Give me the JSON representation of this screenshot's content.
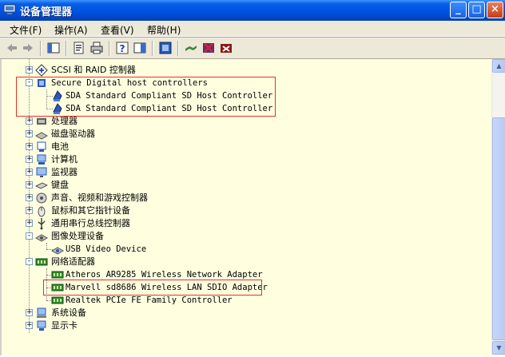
{
  "window": {
    "title": "设备管理器",
    "controls": {
      "minimize": "_",
      "maximize": "□",
      "close": "×"
    }
  },
  "menu": [
    {
      "label": "文件(F)"
    },
    {
      "label": "操作(A)"
    },
    {
      "label": "查看(V)"
    },
    {
      "label": "帮助(H)"
    }
  ],
  "toolbar": {
    "buttons": [
      "back-icon",
      "forward-icon",
      "console-tree-icon",
      "properties-icon",
      "print-icon",
      "help-icon",
      "show-hide-icon",
      "scan-hardware-icon",
      "update-driver-icon",
      "disable-icon",
      "uninstall-icon"
    ]
  },
  "tree": {
    "items": [
      {
        "label": "SCSI 和 RAID 控制器",
        "icon": "scsi-icon",
        "expander": "+"
      },
      {
        "label": "Secure Digital host controllers",
        "icon": "sd-controller-icon",
        "expander": "-"
      },
      {
        "label": "SDA Standard Compliant SD Host Controller",
        "icon": "sd-device-icon"
      },
      {
        "label": "SDA Standard Compliant SD Host Controller",
        "icon": "sd-device-icon"
      },
      {
        "label": "处理器",
        "icon": "processor-icon",
        "expander": "+"
      },
      {
        "label": "磁盘驱动器",
        "icon": "disk-drive-icon",
        "expander": "+"
      },
      {
        "label": "电池",
        "icon": "battery-icon",
        "expander": "+"
      },
      {
        "label": "计算机",
        "icon": "computer-icon",
        "expander": "+"
      },
      {
        "label": "监视器",
        "icon": "monitor-icon",
        "expander": "+"
      },
      {
        "label": "键盘",
        "icon": "keyboard-icon",
        "expander": "+"
      },
      {
        "label": "声音、视频和游戏控制器",
        "icon": "sound-icon",
        "expander": "+"
      },
      {
        "label": "鼠标和其它指针设备",
        "icon": "mouse-icon",
        "expander": "+"
      },
      {
        "label": "通用串行总线控制器",
        "icon": "usb-icon",
        "expander": "+"
      },
      {
        "label": "图像处理设备",
        "icon": "imaging-icon",
        "expander": "-"
      },
      {
        "label": "USB Video Device",
        "icon": "camera-icon"
      },
      {
        "label": "网络适配器",
        "icon": "network-icon",
        "expander": "-"
      },
      {
        "label": "Atheros AR9285 Wireless Network Adapter",
        "icon": "nic-icon"
      },
      {
        "label": "Marvell sd8686 Wireless LAN SDIO Adapter",
        "icon": "nic-icon"
      },
      {
        "label": "Realtek PCIe FE Family Controller",
        "icon": "nic-icon"
      },
      {
        "label": "系统设备",
        "icon": "system-icon",
        "expander": "+"
      },
      {
        "label": "显示卡",
        "icon": "display-adapter-icon",
        "expander": "+"
      }
    ]
  },
  "colors": {
    "highlight_box": "#e0332a",
    "tree_background": "#ffffe0",
    "titlebar": "#0054e3"
  }
}
